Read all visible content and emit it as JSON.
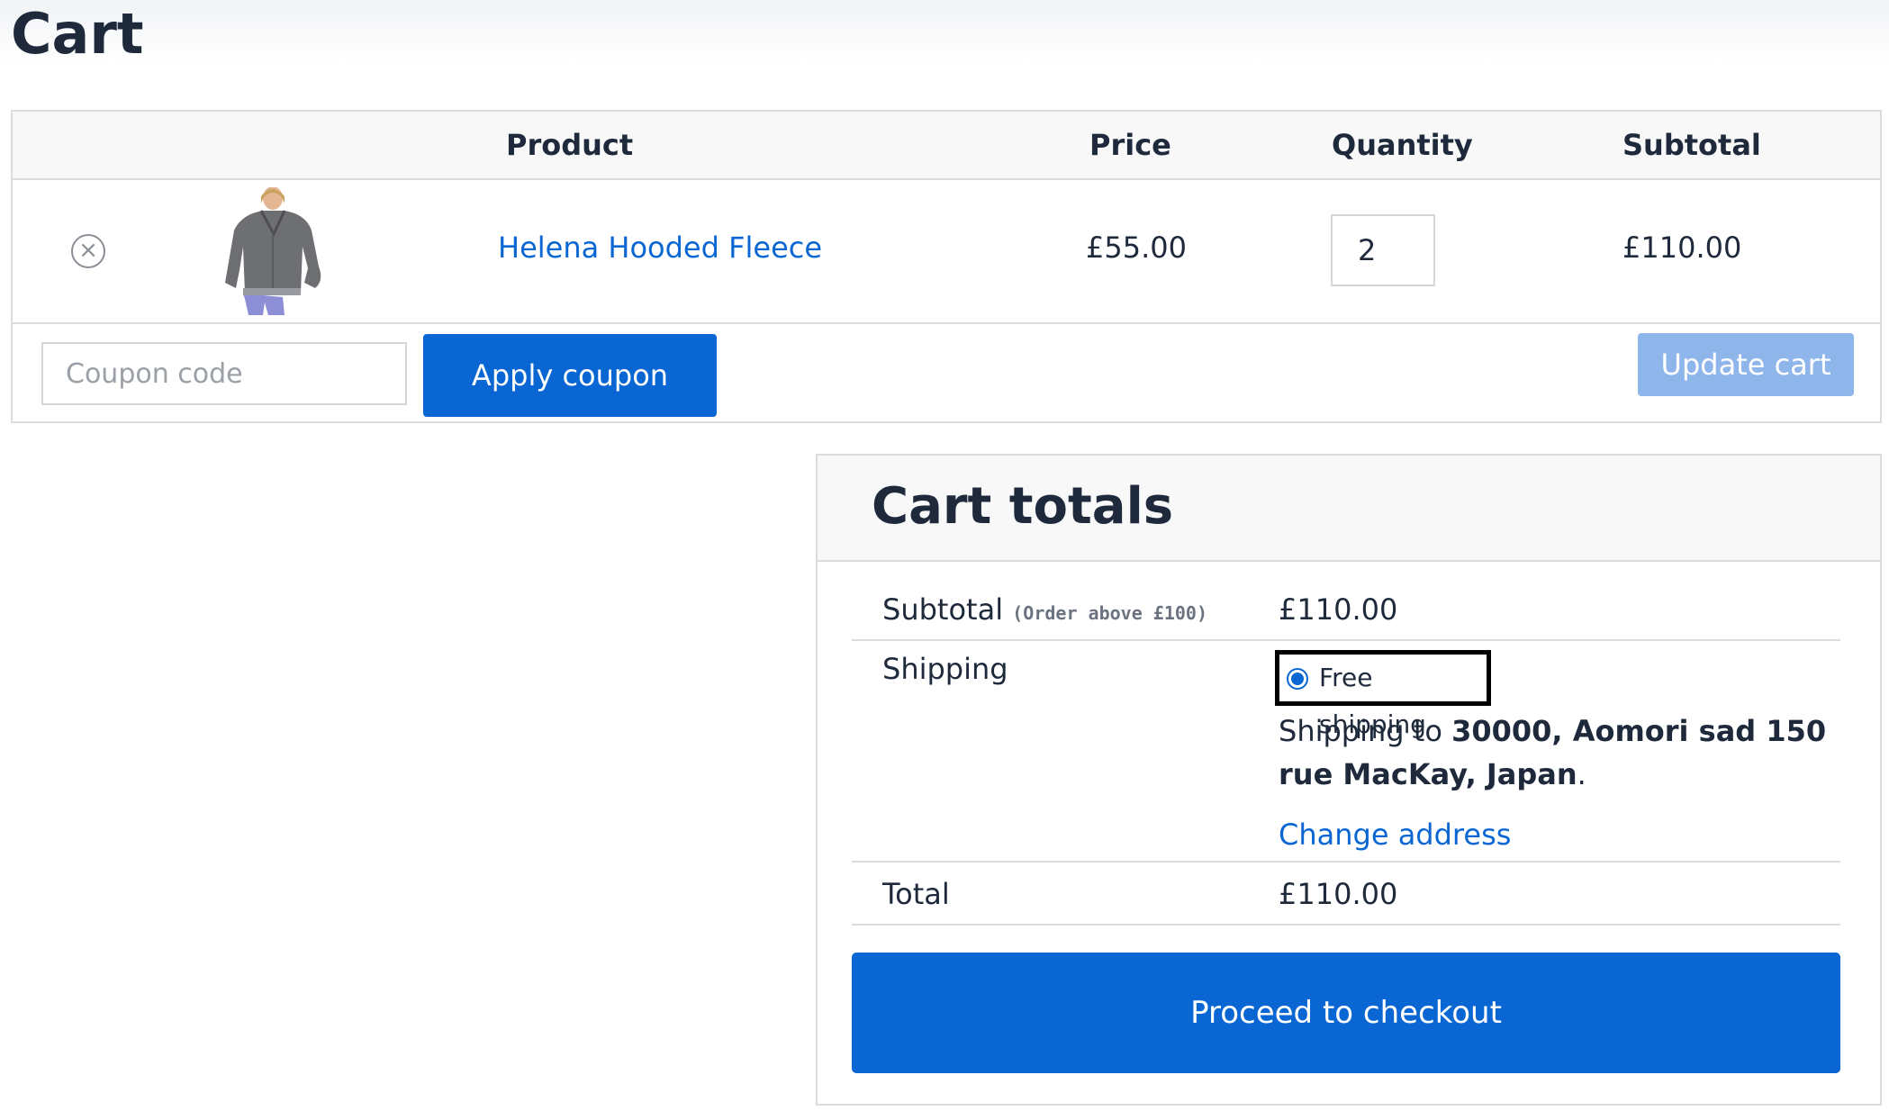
{
  "page": {
    "title": "Cart"
  },
  "table": {
    "headers": {
      "product": "Product",
      "price": "Price",
      "quantity": "Quantity",
      "subtotal": "Subtotal"
    },
    "rows": [
      {
        "remove_icon": "close-circle-icon",
        "product_name": "Helena Hooded Fleece",
        "price": "£55.00",
        "quantity": "2",
        "subtotal": "£110.00"
      }
    ]
  },
  "actions": {
    "coupon_placeholder": "Coupon code",
    "apply_label": "Apply coupon",
    "update_label": "Update cart"
  },
  "totals": {
    "title": "Cart totals",
    "subtotal_label": "Subtotal",
    "subtotal_note": "(Order above £100)",
    "subtotal_value": "£110.00",
    "shipping_label": "Shipping",
    "shipping_option": "Free shipping",
    "shipping_prefix": "Shipping to ",
    "shipping_address": "30000, Aomori sad 150 rue MacKay, Japan",
    "shipping_suffix": ".",
    "change_address": "Change address",
    "total_label": "Total",
    "total_value": "£110.00",
    "checkout_label": "Proceed to checkout"
  },
  "colors": {
    "accent": "#0a66d2",
    "accent_disabled": "#8fb6ea",
    "text": "#1e2a3b",
    "border": "#dcdcde",
    "header_bg": "#f8f8f9"
  }
}
